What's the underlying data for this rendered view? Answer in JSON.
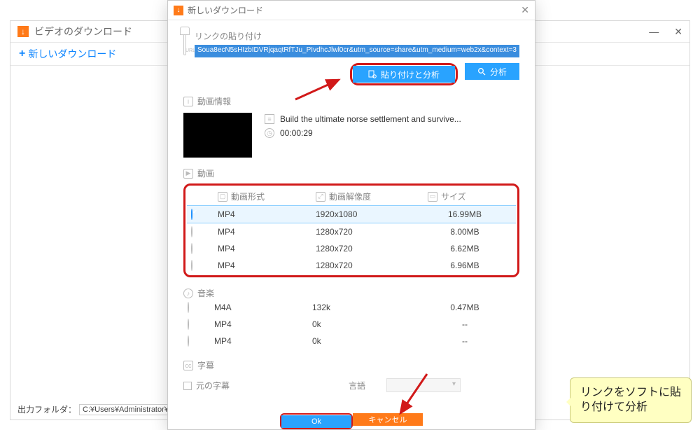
{
  "parent": {
    "title": "ビデオのダウンロード",
    "new_download": "新しいダウンロード",
    "output_label": "出力フォルダ：",
    "output_path": "C:¥Users¥Administrator¥Vide"
  },
  "modal": {
    "title": "新しいダウンロード",
    "paste_label": "リンクの貼り付け",
    "url_value": "Soua8ecN5sHIzbIDVRjqaqtRfTJu_PIvdhcJlwl0cr&utm_source=share&utm_medium=web2x&context=3",
    "btn_paste_analyze": "貼り付けと分析",
    "btn_analyze": "分析",
    "section_info": "動画情報",
    "video_title": "Build the ultimate norse settlement and survive...",
    "duration": "00:00:29",
    "section_video": "動画",
    "col_format": "動画形式",
    "col_resolution": "動画解像度",
    "col_size": "サイズ",
    "video_rows": [
      {
        "fmt": "MP4",
        "res": "1920x1080",
        "size": "16.99MB",
        "sel": true
      },
      {
        "fmt": "MP4",
        "res": "1280x720",
        "size": "8.00MB",
        "sel": false
      },
      {
        "fmt": "MP4",
        "res": "1280x720",
        "size": "6.62MB",
        "sel": false
      },
      {
        "fmt": "MP4",
        "res": "1280x720",
        "size": "6.96MB",
        "sel": false
      }
    ],
    "section_music": "音楽",
    "music_rows": [
      {
        "fmt": "M4A",
        "res": "132k",
        "size": "0.47MB"
      },
      {
        "fmt": "MP4",
        "res": "0k",
        "size": "--"
      },
      {
        "fmt": "MP4",
        "res": "0k",
        "size": "--"
      }
    ],
    "section_sub": "字幕",
    "orig_sub": "元の字幕",
    "lang_label": "言語",
    "btn_ok": "Ok",
    "btn_cancel": "キャンセル"
  },
  "tip": {
    "line1": "リンクをソフトに貼",
    "line2": "り付けて分析"
  }
}
